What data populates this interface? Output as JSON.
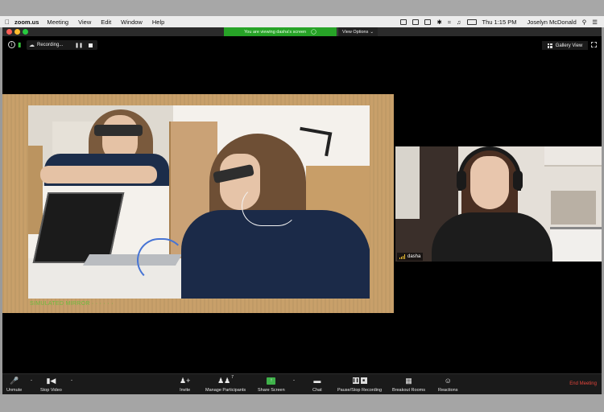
{
  "menubar": {
    "app": "zoom.us",
    "items": [
      "Meeting",
      "View",
      "Edit",
      "Window",
      "Help"
    ],
    "clock": "Thu 1:15 PM",
    "user": "Joselyn McDonald"
  },
  "window": {
    "viewing_banner": "You are viewing dasha's screen",
    "view_options": "View Options",
    "recording": "Recording...",
    "gallery_view": "Gallery View"
  },
  "shared_screen": {
    "caption": "SIMULATED MIRROR · · · · · ·"
  },
  "participant": {
    "name": "dasha"
  },
  "toolbar": {
    "unmute": "Unmute",
    "stop_video": "Stop Video",
    "invite": "Invite",
    "manage_participants": "Manage Participants",
    "participant_count": "7",
    "share_screen": "Share Screen",
    "chat": "Chat",
    "pause_stop_recording": "Pause/Stop Recording",
    "breakout_rooms": "Breakout Rooms",
    "reactions": "Reactions",
    "end_meeting": "End Meeting"
  },
  "colors": {
    "banner_green": "#27a327",
    "end_meeting_red": "#e5453b",
    "share_green": "#3fb24a"
  }
}
